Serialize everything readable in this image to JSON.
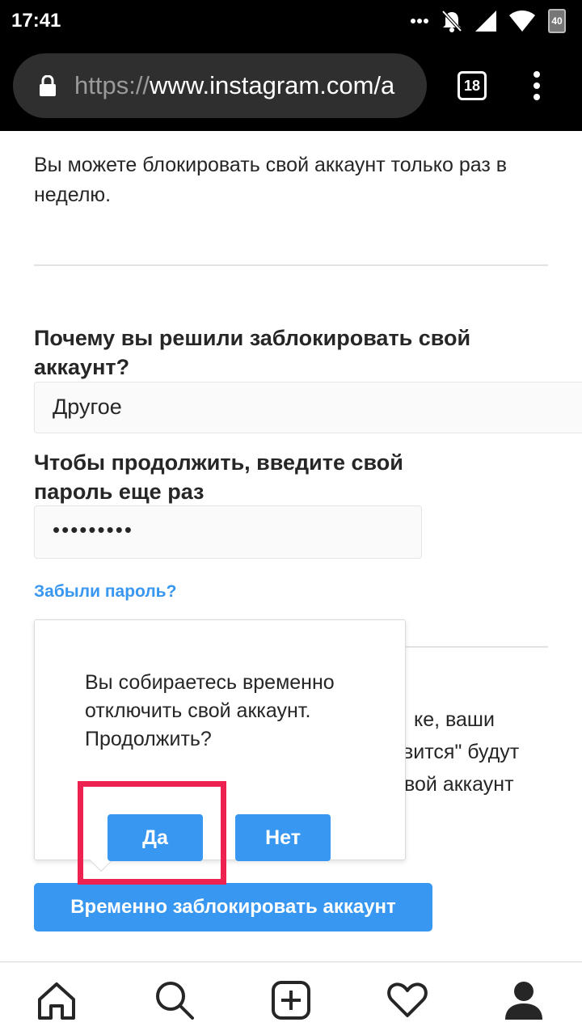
{
  "status_bar": {
    "time": "17:41",
    "battery_level": "40",
    "icons": [
      "more-dots-icon",
      "notifications-off-icon",
      "signal-icon",
      "wifi-icon",
      "battery-icon"
    ]
  },
  "browser": {
    "url_scheme": "https://",
    "url_host": "www.instagram.com/a",
    "tab_count": "18"
  },
  "content": {
    "intro_text": "Вы можете блокировать свой аккаунт только раз в неделю.",
    "reason_heading": "Почему вы решили заблокировать свой аккаунт?",
    "reason_value": "Другое",
    "password_heading": "Чтобы продолжить, введите свой пароль еще раз",
    "password_value": "•••••••••",
    "forgot_link": "Забыли пароль?",
    "behind_fragment_1": "ке, ваши",
    "behind_fragment_2": "вится\" будут",
    "behind_fragment_3": "вой аккаунт",
    "block_button": "Временно заблокировать аккаунт"
  },
  "popup": {
    "message": "Вы собираетесь временно отключить свой аккаунт. Продолжить?",
    "yes_label": "Да",
    "no_label": "Нет"
  },
  "colors": {
    "accent": "#3897f0",
    "highlight": "#ee2250"
  },
  "bottom_nav": [
    "home-icon",
    "search-icon",
    "new-post-icon",
    "activity-heart-icon",
    "profile-icon"
  ]
}
